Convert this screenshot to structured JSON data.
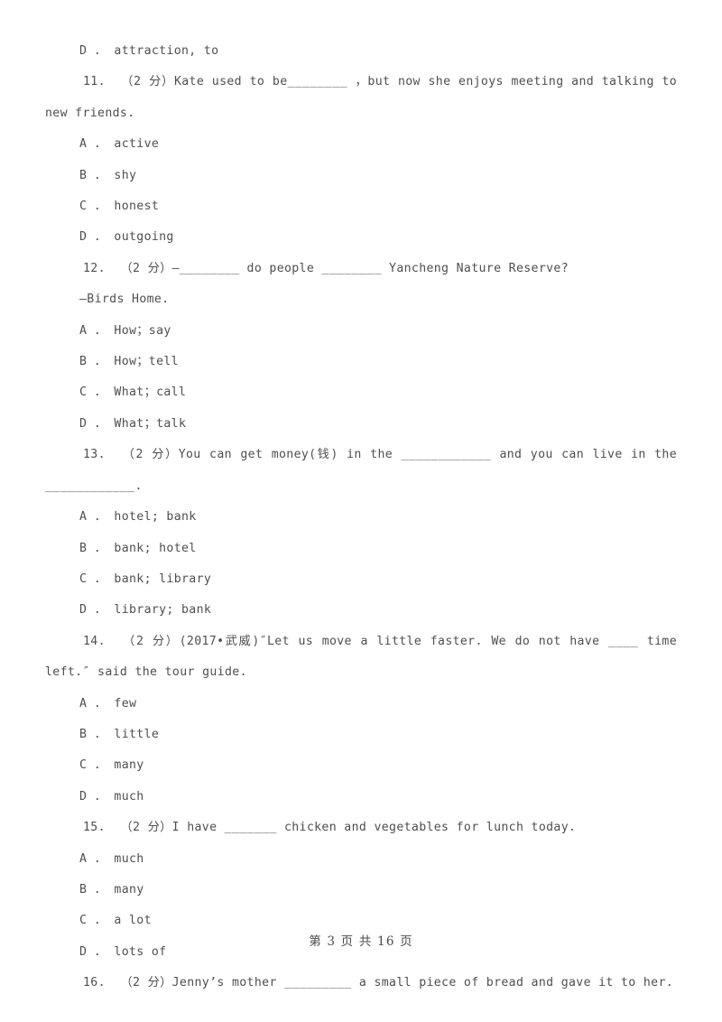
{
  "document": {
    "page_label": "第 3 页 共 16 页",
    "text_color": "#4f4f4f",
    "background_color": "#ffffff"
  },
  "blocks": [
    {
      "kind": "option",
      "text": "D ． attraction, to"
    },
    {
      "kind": "question",
      "text": "11.  （2 分）Kate used to be________ ，but now she enjoys meeting and talking to new friends."
    },
    {
      "kind": "option",
      "text": "A ． active"
    },
    {
      "kind": "option",
      "text": "B ． shy"
    },
    {
      "kind": "option",
      "text": "C ． honest"
    },
    {
      "kind": "option",
      "text": "D ． outgoing"
    },
    {
      "kind": "question",
      "text": "12.  （2 分）—________ do people ________ Yancheng Nature Reserve?"
    },
    {
      "kind": "cont",
      "text": "—Birds Home."
    },
    {
      "kind": "option",
      "text": "A ． How；say"
    },
    {
      "kind": "option",
      "text": "B ． How；tell"
    },
    {
      "kind": "option",
      "text": "C ． What；call"
    },
    {
      "kind": "option",
      "text": "D ． What；talk"
    },
    {
      "kind": "question",
      "text": "13.  （2 分）You can get money(钱) in the ____________ and you can live in the ____________."
    },
    {
      "kind": "option",
      "text": "A ． hotel; bank"
    },
    {
      "kind": "option",
      "text": "B ． bank; hotel"
    },
    {
      "kind": "option",
      "text": "C ． bank; library"
    },
    {
      "kind": "option",
      "text": "D ． library; bank"
    },
    {
      "kind": "question",
      "text": "14.  （2 分）(2017•武威)″Let us move a little faster. We do not have ____ time left.″ said the tour guide."
    },
    {
      "kind": "option",
      "text": "A ． few"
    },
    {
      "kind": "option",
      "text": "B ． little"
    },
    {
      "kind": "option",
      "text": "C ． many"
    },
    {
      "kind": "option",
      "text": "D ． much"
    },
    {
      "kind": "question",
      "text": "15.  （2 分）I have _______ chicken and vegetables for lunch today."
    },
    {
      "kind": "option",
      "text": "A ． much"
    },
    {
      "kind": "option",
      "text": "B ． many"
    },
    {
      "kind": "option",
      "text": "C ． a lot"
    },
    {
      "kind": "option",
      "text": "D ． lots of"
    },
    {
      "kind": "question",
      "text": "16.  （2 分）Jenny’s mother _________ a small piece of bread and gave it to her."
    }
  ]
}
